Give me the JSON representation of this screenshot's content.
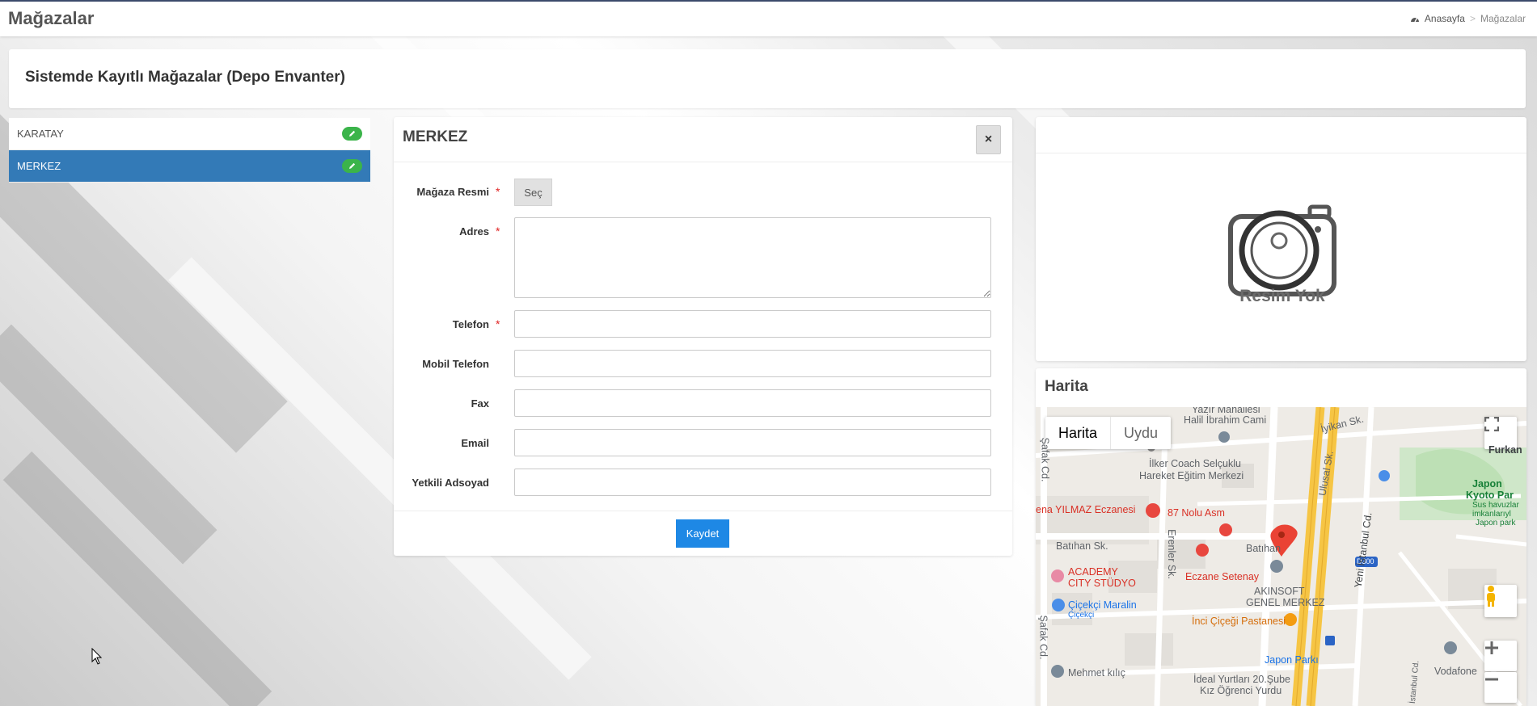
{
  "page": {
    "title": "Mağazalar",
    "breadcrumb": {
      "home": "Anasayfa",
      "separator": ">",
      "current": "Mağazalar"
    }
  },
  "header": {
    "title": "Sistemde Kayıtlı Mağazalar (Depo Envanter)"
  },
  "stores": [
    {
      "name": "KARATAY",
      "active": false
    },
    {
      "name": "MERKEZ",
      "active": true
    }
  ],
  "form": {
    "title": "MERKEZ",
    "close_label": "×",
    "fields": {
      "image": {
        "label": "Mağaza Resmi",
        "required": "*",
        "button": "Seç"
      },
      "address": {
        "label": "Adres",
        "required": "*",
        "value": ""
      },
      "phone": {
        "label": "Telefon",
        "required": "*",
        "value": ""
      },
      "mobile": {
        "label": "Mobil Telefon",
        "value": ""
      },
      "fax": {
        "label": "Fax",
        "value": ""
      },
      "email": {
        "label": "Email",
        "value": ""
      },
      "contact": {
        "label": "Yetkili Adsoyad",
        "value": ""
      }
    },
    "save_label": "Kaydet"
  },
  "photo": {
    "placeholder_text": "Resim Yok"
  },
  "map": {
    "title": "Harita",
    "type_map": "Harita",
    "type_satellite": "Uydu",
    "labels": {
      "yazir": "Yazır Mahallesi",
      "halil": "Halil İbrahim Cami",
      "iyikan": "İyikan Sk.",
      "furkan": "Furkan",
      "ilker1": "İlker Coach Selçuklu",
      "ilker2": "Hareket Eğitim Merkezi",
      "safak1": "Şafak Cd.",
      "ulusal": "Ulusal Sk.",
      "japon1": "Japon",
      "japon2": "Kyoto Par",
      "japon3": "Sus havuzlar",
      "japon4": "imkanlarıyl",
      "japon5": "Japon park",
      "yilmaz": "ena YILMAZ Eczanesi",
      "nolu": "87 Nolu Asm",
      "batihan1": "Batıhan Sk.",
      "batihan2": "Batıhan",
      "erenler": "Erenler Sk.",
      "d300": "D300",
      "yeni": "Yeni İstanbul Cd.",
      "academy1": "ACADEMY",
      "academy2": "CITY STÜDYO",
      "setenay": "Eczane Setenay",
      "akin1": "AKINSOFT",
      "akin2": "GENEL MERKEZ",
      "cicekci1": "Çiçekçi Maralin",
      "cicekci2": "Çiçekçi",
      "inci": "İnci Çiçeği Pastanesi",
      "safak2": "Şafak Cd.",
      "japonparki": "Japon Parkı",
      "mehmet": "Mehmet kılıç",
      "ideal1": "İdeal Yurtları 20.Şube",
      "ideal2": "Kız Öğrenci Yurdu",
      "vodafone": "Vodafone",
      "istcd": "İstanbul Cd."
    }
  },
  "colors": {
    "active_store": "#337ab7",
    "edit_button": "#3bb44a",
    "save_button": "#1e88e5",
    "required_mark": "#e02222",
    "map_pin": "#ea4335"
  }
}
